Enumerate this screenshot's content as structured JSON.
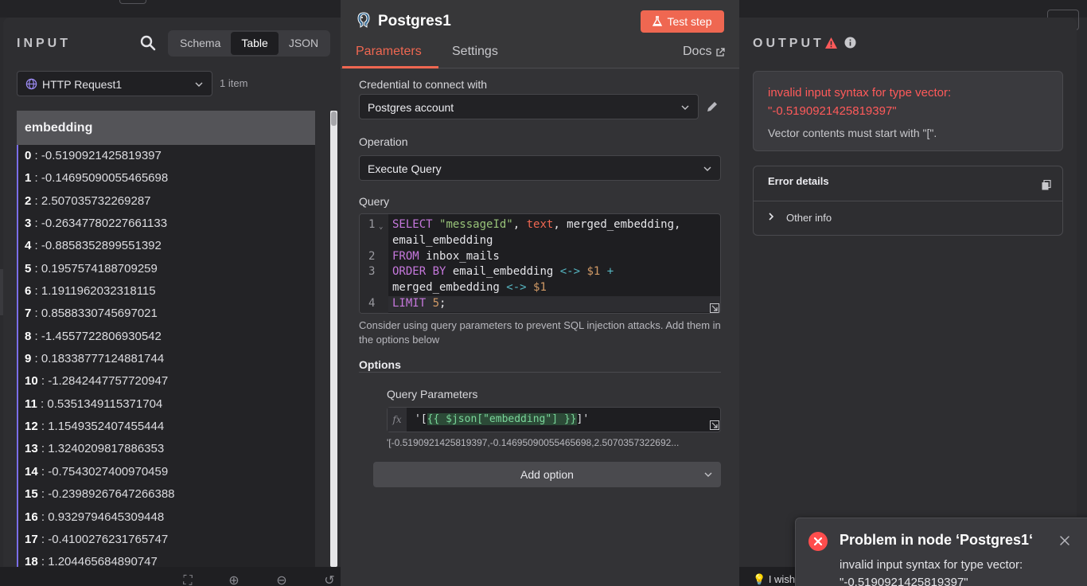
{
  "input": {
    "label": "INPUT",
    "view_tabs": [
      "Schema",
      "Table",
      "JSON"
    ],
    "active_tab": "Table",
    "source_node": "HTTP Request1",
    "item_count": "1 item",
    "column_header": "embedding",
    "rows": [
      {
        "index": "0",
        "value": "-0.5190921425819397"
      },
      {
        "index": "1",
        "value": "-0.14695090055465698"
      },
      {
        "index": "2",
        "value": "2.507035732269287"
      },
      {
        "index": "3",
        "value": "-0.26347780227661133"
      },
      {
        "index": "4",
        "value": "-0.8858352899551392"
      },
      {
        "index": "5",
        "value": "0.1957574188709259"
      },
      {
        "index": "6",
        "value": "1.1911962032318115"
      },
      {
        "index": "7",
        "value": "0.8588330745697021"
      },
      {
        "index": "8",
        "value": "-1.4557722806930542"
      },
      {
        "index": "9",
        "value": "0.18338777124881744"
      },
      {
        "index": "10",
        "value": "-1.2842447757720947"
      },
      {
        "index": "11",
        "value": "0.5351349115371704"
      },
      {
        "index": "12",
        "value": "1.1549352407455444"
      },
      {
        "index": "13",
        "value": "1.3240209817886353"
      },
      {
        "index": "14",
        "value": "-0.7543027400970459"
      },
      {
        "index": "15",
        "value": "-0.23989267647266388"
      },
      {
        "index": "16",
        "value": "0.9329794645309448"
      },
      {
        "index": "17",
        "value": "-0.4100276231765747"
      },
      {
        "index": "18",
        "value": "1.204465684890747"
      }
    ]
  },
  "node": {
    "title": "Postgres1",
    "test_button": "Test step",
    "tabs": [
      "Parameters",
      "Settings"
    ],
    "docs_label": "Docs",
    "credential_label": "Credential to connect with",
    "credential_value": "Postgres account",
    "operation_label": "Operation",
    "operation_value": "Execute Query",
    "query_label": "Query",
    "query_line_numbers": [
      "1",
      "2",
      "3",
      "4"
    ],
    "query_hint": "Consider using query parameters to prevent SQL injection attacks. Add them in the options below",
    "options_title": "Options",
    "query_params_label": "Query Parameters",
    "query_params_expression_prefix": "'[",
    "query_params_expression_template": "{{ $json[\"embedding\"] }}",
    "query_params_expression_suffix": "]'",
    "query_params_fx": "fx",
    "query_params_preview": "'[-0.5190921425819397,-0.14695090055465698,2.5070357322692...",
    "add_option_label": "Add option"
  },
  "output": {
    "label": "OUTPUT",
    "error_title": "invalid input syntax for type vector: \"-0.5190921425819397\"",
    "error_description": "Vector contents must start with \"[\".",
    "details_title": "Error details",
    "other_info_label": "Other info"
  },
  "toast": {
    "title": "Problem in node ‘Postgres1‘",
    "message": "invalid input syntax for type vector: \"-0.5190921425819397\""
  },
  "footer": {
    "wish_text": "I wish"
  },
  "colors": {
    "accent": "#ef6751",
    "error": "#ff5a5a",
    "table_accent": "#7a6ee8"
  }
}
